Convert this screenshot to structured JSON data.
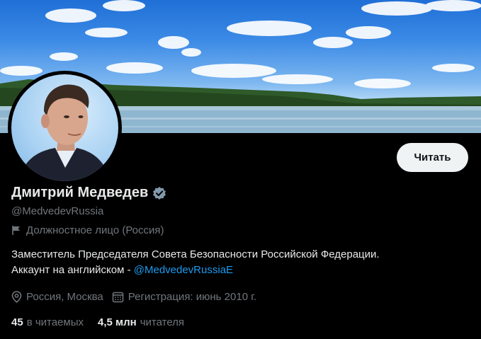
{
  "profile": {
    "name": "Дмитрий Медведев",
    "handle": "@MedvedevRussia",
    "category": "Должностное лицо (Россия)",
    "bio_line1": "Заместитель Председателя Совета Безопасности Российской Федерации.",
    "bio_line2_prefix": "Аккаунт на английском - ",
    "bio_link": "@MedvedevRussiaE",
    "location": "Россия, Москва",
    "joined": "Регистрация: июнь 2010 г.",
    "following_count": "45",
    "following_label": "в читаемых",
    "followers_count": "4,5 млн",
    "followers_label": "читателя"
  },
  "actions": {
    "follow_label": "Читать"
  },
  "icons": {
    "verified": "verified-badge-icon",
    "category": "flag-icon",
    "location": "location-pin-icon",
    "joined": "calendar-icon"
  },
  "colors": {
    "background": "#000000",
    "text_primary": "#e7e9ea",
    "text_secondary": "#71767b",
    "link": "#1d9bf0",
    "button_bg": "#eff3f4"
  }
}
